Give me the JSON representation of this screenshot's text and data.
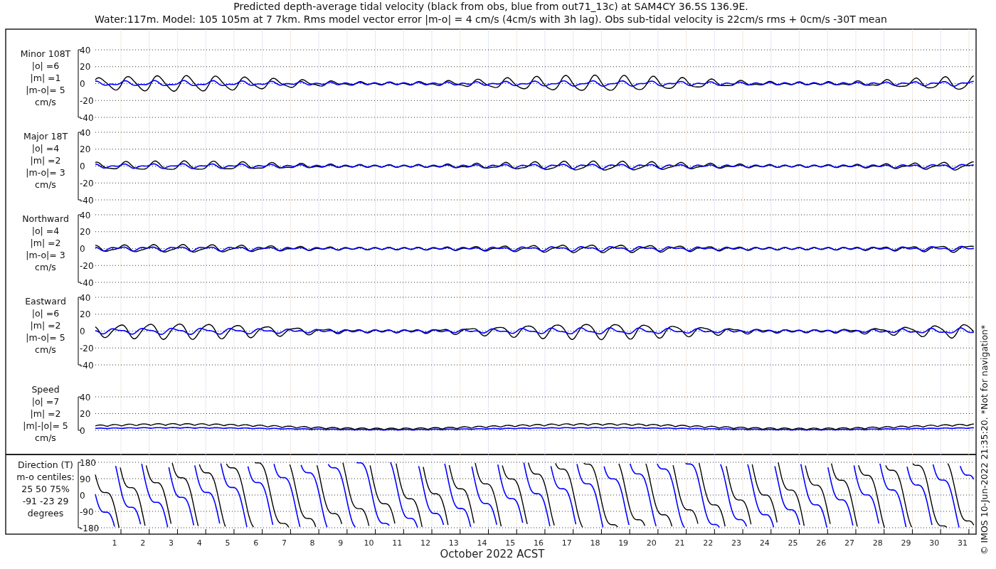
{
  "title_lines": [
    "Predicted depth-average tidal velocity (black from obs, blue from out71_13c) at SAM4CY 36.5S 136.9E.",
    "Water:117m. Model: 105 105m at 7 7km. Rms model vector error |m-o| = 4 cm/s (4cm/s with 3h lag). Obs sub-tidal velocity is 22cm/s rms + 0cm/s -30T mean"
  ],
  "panels": [
    {
      "kind": "velocity",
      "label_lines": [
        "Minor 108T",
        "|o| =6",
        "|m| =1",
        "|m-o|= 5",
        "cm/s"
      ],
      "yticks": [
        "40",
        "20",
        "0",
        "-20",
        "-40"
      ]
    },
    {
      "kind": "velocity",
      "label_lines": [
        "Major 18T",
        "|o| =4",
        "|m| =2",
        "|m-o|= 3",
        "cm/s"
      ],
      "yticks": [
        "40",
        "20",
        "0",
        "-20",
        "-40"
      ]
    },
    {
      "kind": "velocity",
      "label_lines": [
        "Northward",
        "|o| =4",
        "|m| =2",
        "|m-o|= 3",
        "cm/s"
      ],
      "yticks": [
        "40",
        "20",
        "0",
        "-20",
        "-40"
      ]
    },
    {
      "kind": "velocity",
      "label_lines": [
        "Eastward",
        "|o| =6",
        "|m| =2",
        "|m-o|= 5",
        "cm/s"
      ],
      "yticks": [
        "40",
        "20",
        "0",
        "-20",
        "-40"
      ]
    },
    {
      "kind": "speed",
      "label_lines": [
        "Speed",
        "|o| =7",
        "|m| =2",
        "|m|-|o|= 5",
        "cm/s"
      ],
      "yticks": [
        "40",
        "20",
        "0"
      ]
    },
    {
      "kind": "direction",
      "label_lines": [
        "Direction (T)",
        "m-o centiles:",
        "25  50  75%",
        "-91 -23  29",
        "degrees"
      ],
      "yticks": [
        "180",
        "90",
        "0",
        "-90",
        "-180"
      ]
    }
  ],
  "x_axis": {
    "ticks": [
      "1",
      "2",
      "3",
      "4",
      "5",
      "6",
      "7",
      "8",
      "9",
      "10",
      "11",
      "12",
      "13",
      "14",
      "15",
      "16",
      "17",
      "18",
      "19",
      "20",
      "21",
      "22",
      "23",
      "24",
      "25",
      "26",
      "27",
      "28",
      "29",
      "30",
      "31"
    ],
    "label": "October 2022 ACST"
  },
  "footer_note": "© IMOS 10-Jun-2022 21:35:20.  *Not for navigation*"
}
